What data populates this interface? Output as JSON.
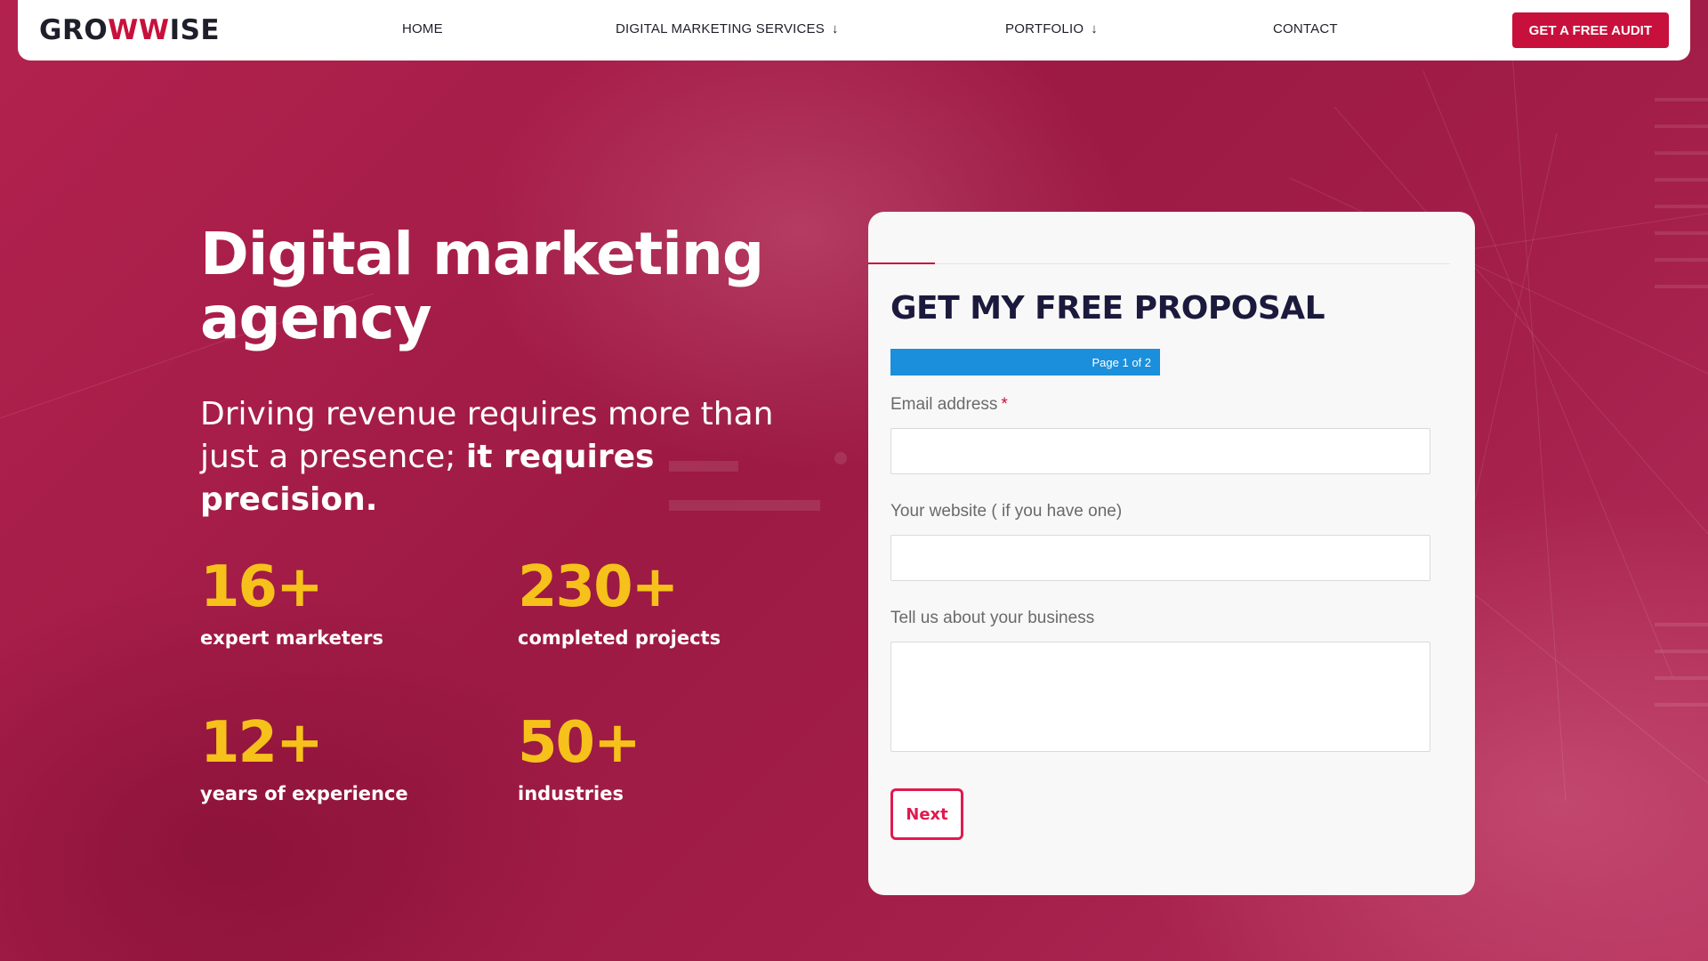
{
  "brand": {
    "logo_start": "GRO",
    "logo_w": "WW",
    "logo_end": "ISE",
    "accent": "#c8103c",
    "highlight": "#f6c11a"
  },
  "nav": {
    "items": [
      {
        "label": "HOME",
        "has_dropdown": false
      },
      {
        "label": "DIGITAL MARKETING SERVICES",
        "has_dropdown": true
      },
      {
        "label": "PORTFOLIO",
        "has_dropdown": true
      },
      {
        "label": "CONTACT",
        "has_dropdown": false
      }
    ],
    "cta_label": "GET A FREE AUDIT",
    "dropdown_icon": "arrow-down-icon"
  },
  "hero": {
    "title_line1": "Digital marketing",
    "title_line2": "agency",
    "subtitle_start": "Driving revenue requires more than just a presence; ",
    "subtitle_bold": "it requires precision.",
    "stats": [
      {
        "value": "16+",
        "label": "expert marketers"
      },
      {
        "value": "230+",
        "label": "completed projects"
      },
      {
        "value": "12+",
        "label": "years of experience"
      },
      {
        "value": "50+",
        "label": "industries"
      }
    ]
  },
  "form": {
    "title": "GET MY FREE PROPOSAL",
    "progress_text": "Page 1 of 2",
    "progress_color": "#1b8fdb",
    "email_label": "Email address",
    "required_mark": "*",
    "email_value": "",
    "website_label": "Your website ( if you have one)",
    "website_value": "",
    "business_label": "Tell us about your business",
    "business_value": "",
    "next_label": "Next"
  }
}
